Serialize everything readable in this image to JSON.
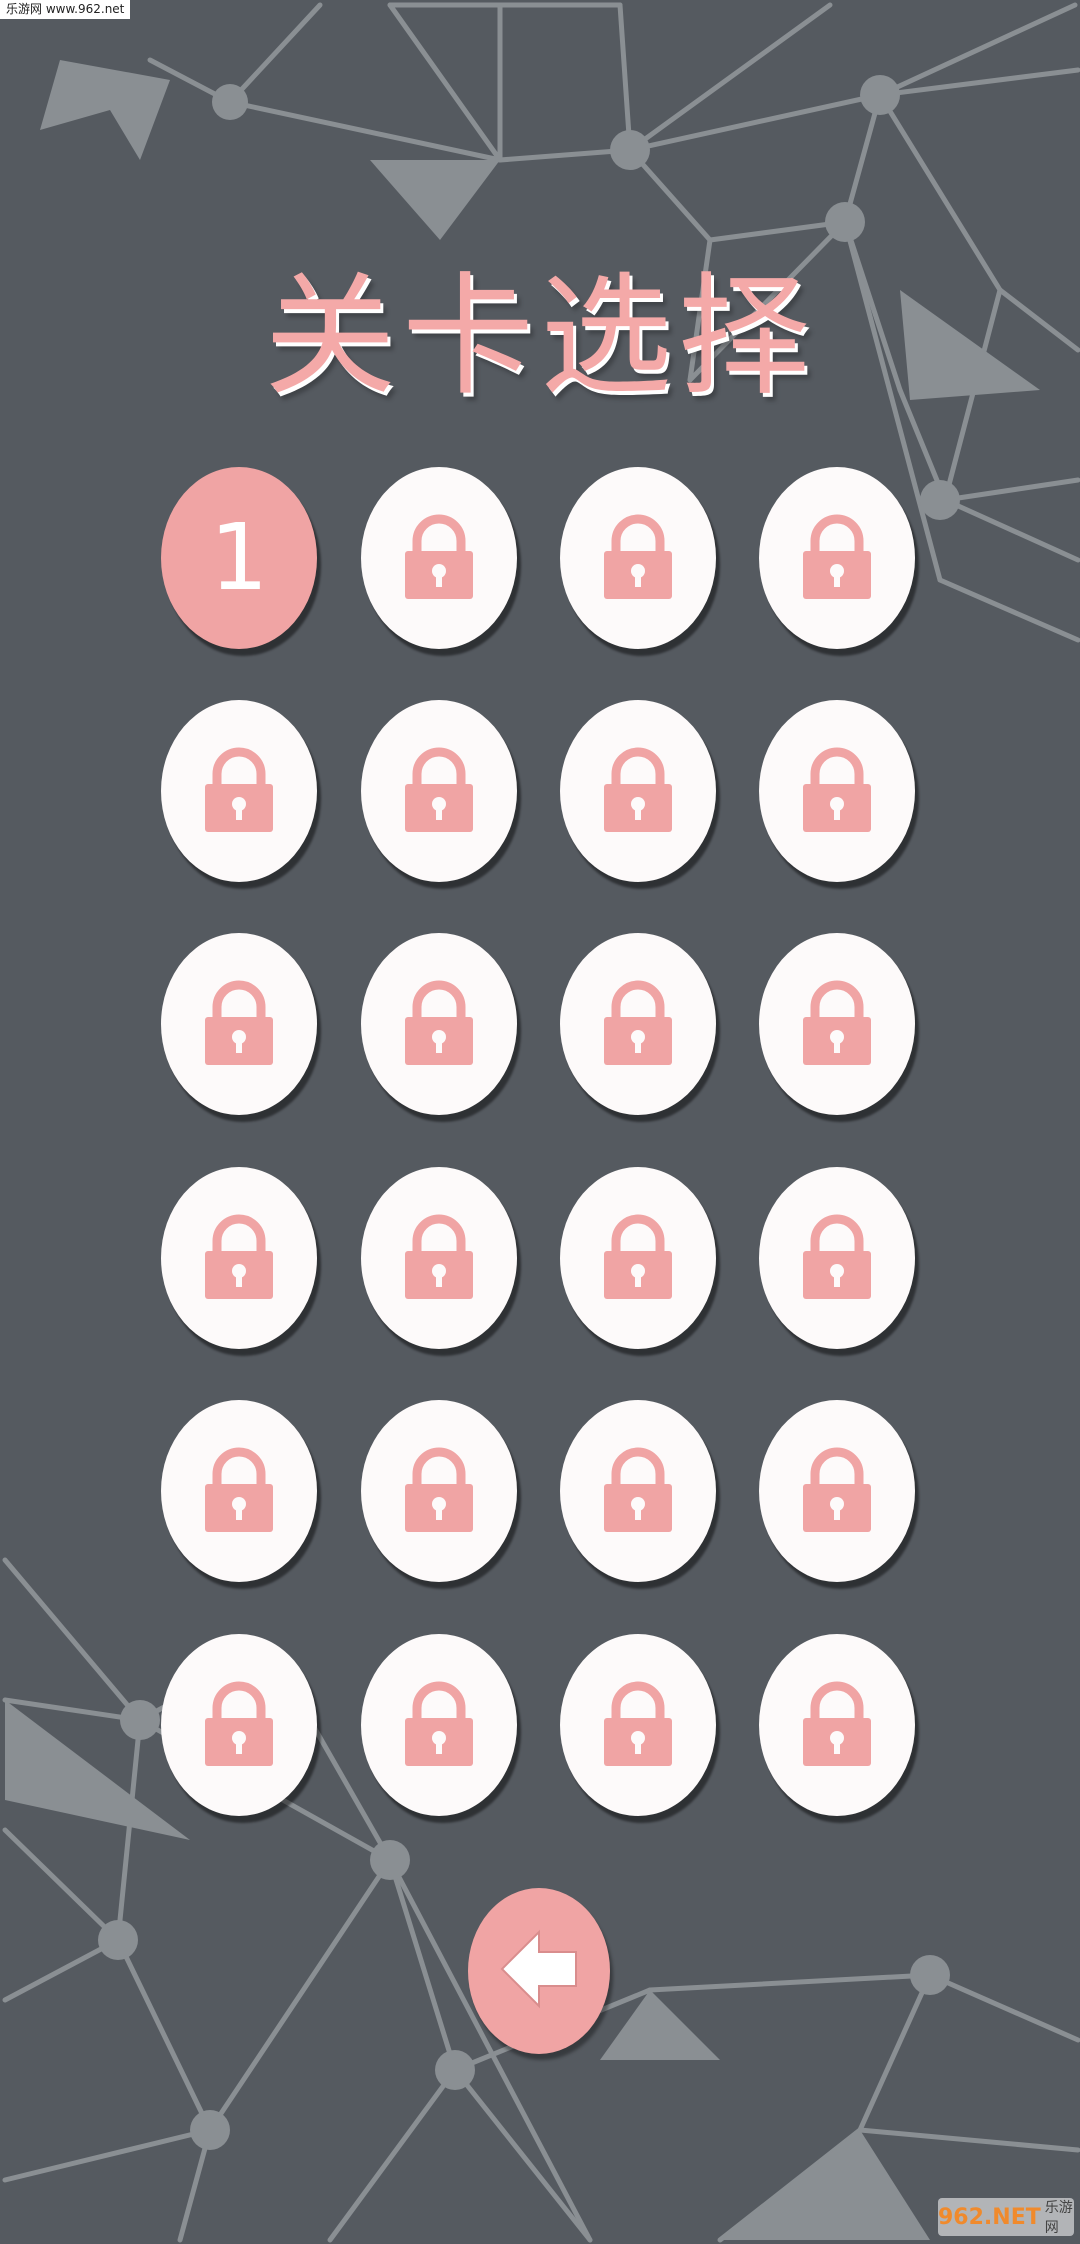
{
  "watermark_top": "乐游网 www.962.net",
  "title": "关卡选择",
  "levels": [
    {
      "label": "1",
      "locked": false
    },
    {
      "label": "",
      "locked": true
    },
    {
      "label": "",
      "locked": true
    },
    {
      "label": "",
      "locked": true
    },
    {
      "label": "",
      "locked": true
    },
    {
      "label": "",
      "locked": true
    },
    {
      "label": "",
      "locked": true
    },
    {
      "label": "",
      "locked": true
    },
    {
      "label": "",
      "locked": true
    },
    {
      "label": "",
      "locked": true
    },
    {
      "label": "",
      "locked": true
    },
    {
      "label": "",
      "locked": true
    },
    {
      "label": "",
      "locked": true
    },
    {
      "label": "",
      "locked": true
    },
    {
      "label": "",
      "locked": true
    },
    {
      "label": "",
      "locked": true
    },
    {
      "label": "",
      "locked": true
    },
    {
      "label": "",
      "locked": true
    },
    {
      "label": "",
      "locked": true
    },
    {
      "label": "",
      "locked": true
    },
    {
      "label": "",
      "locked": true
    },
    {
      "label": "",
      "locked": true
    },
    {
      "label": "",
      "locked": true
    },
    {
      "label": "",
      "locked": true
    }
  ],
  "back_icon": "left-arrow-icon",
  "lock_icon": "padlock-icon",
  "watermark_bottom": {
    "main": "962.NET",
    "sub": "乐游网"
  },
  "colors": {
    "background": "#555a60",
    "accent_pink": "#f0a4a4",
    "title_pink": "#f4a9a8",
    "button_white": "#fdfafa",
    "lines": "#8a8f93"
  }
}
